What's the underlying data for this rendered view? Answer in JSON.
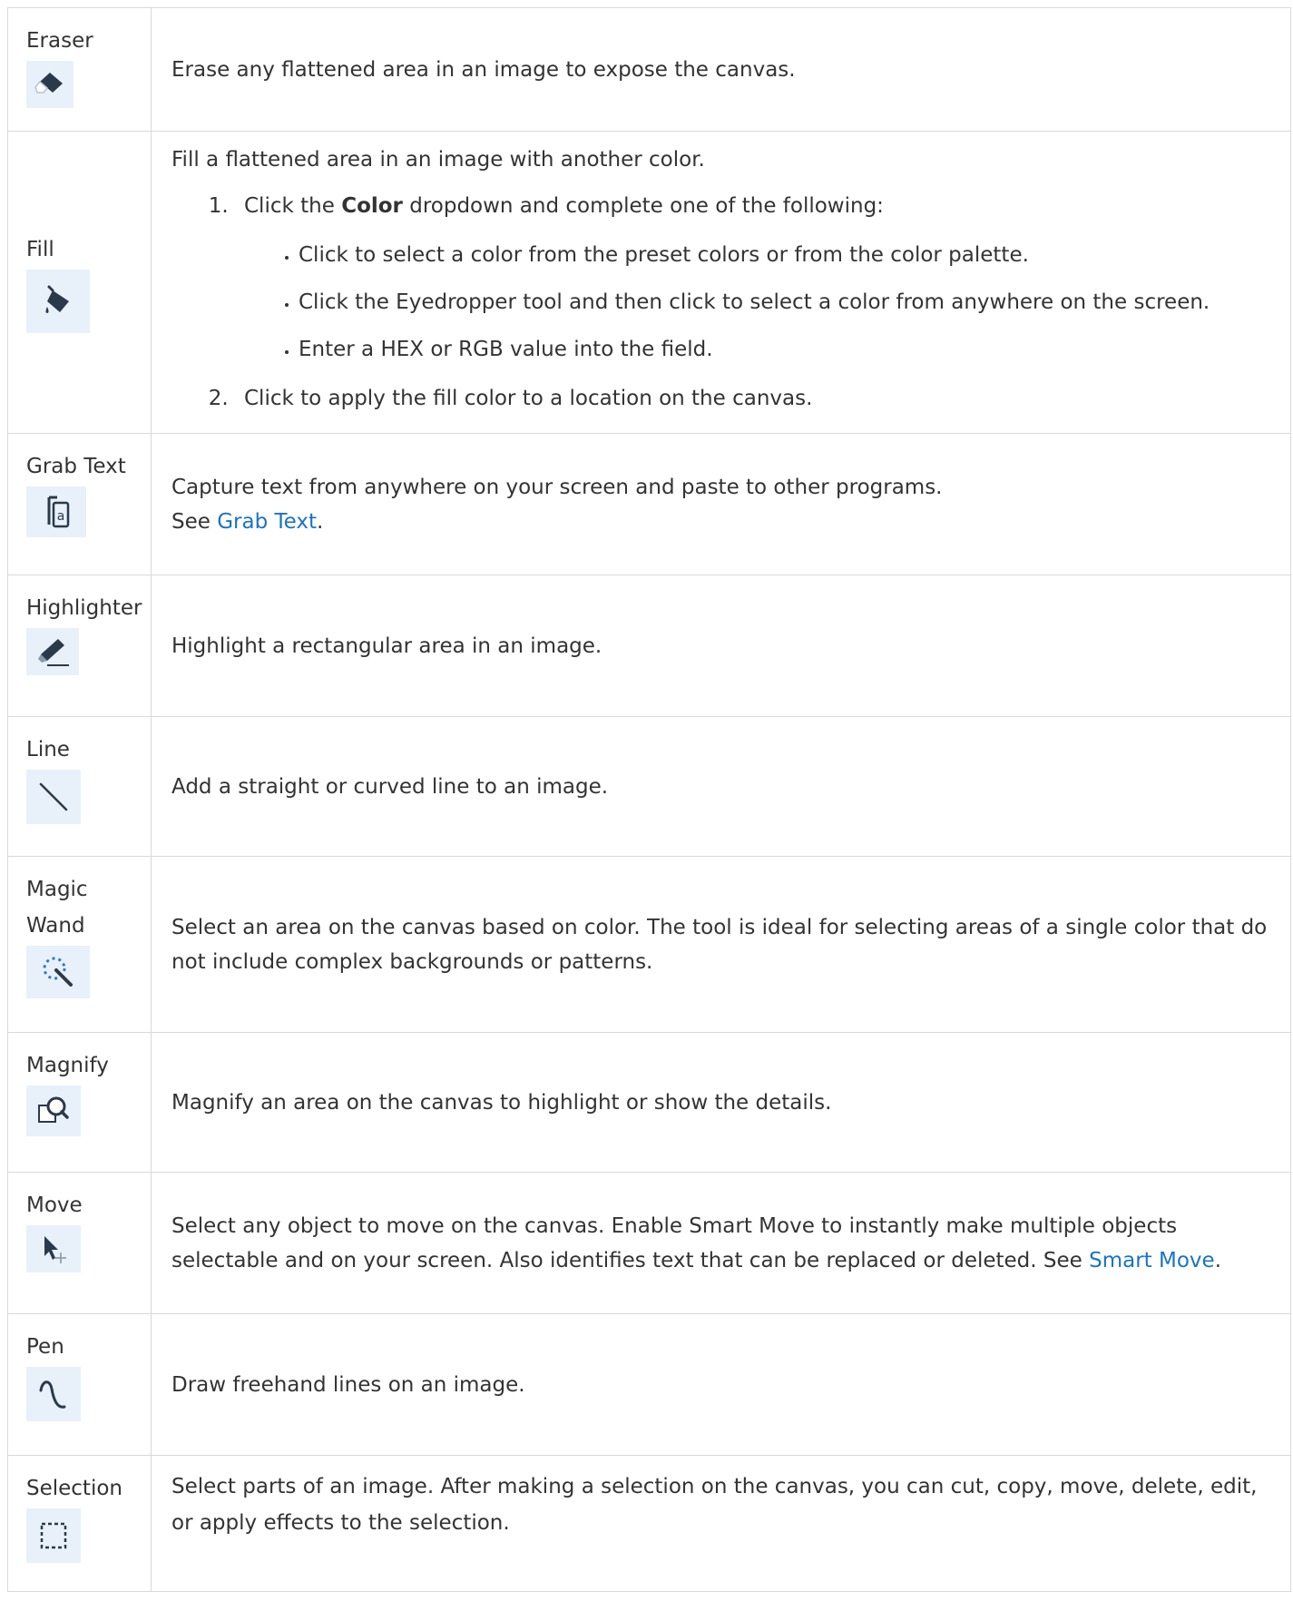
{
  "tools": [
    {
      "name": "Eraser",
      "icon": "eraser-icon",
      "desc": "Erase any flattened area in an image to expose the canvas."
    },
    {
      "name": "Fill",
      "icon": "fill-bucket-icon",
      "intro": "Fill a flattened area in an image with another color.",
      "step1_pre": "Click the ",
      "step1_bold": "Color",
      "step1_post": " dropdown and complete one of the following:",
      "options": [
        "Click to select a color from the preset colors or from the color palette.",
        "Click the Eyedropper tool and then click to select a color from anywhere on the screen.",
        "Enter a HEX or RGB value into the field."
      ],
      "step2": "Click to apply the fill color to a location on the canvas."
    },
    {
      "name": "Grab Text",
      "icon": "grab-text-icon",
      "line1": "Capture text from anywhere on your screen and paste to other programs.",
      "see_pre": "See ",
      "link": "Grab Text",
      "see_post": "."
    },
    {
      "name": "Highlighter",
      "icon": "highlighter-icon",
      "desc": "Highlight a rectangular area in an image."
    },
    {
      "name": "Line",
      "icon": "line-icon",
      "desc": "Add a straight or curved line to an image."
    },
    {
      "name": "Magic Wand",
      "icon": "magic-wand-icon",
      "desc": "Select an area on the canvas based on color. The tool is ideal for selecting areas of a single color that do not include complex backgrounds or patterns."
    },
    {
      "name": "Magnify",
      "icon": "magnify-icon",
      "desc": "Magnify an area on the canvas to highlight or show the details."
    },
    {
      "name": "Move",
      "icon": "move-icon",
      "desc_pre": "Select any object to move on the canvas. Enable Smart Move to instantly make multiple objects selectable and on your screen. Also identifies text that can be replaced or deleted. See ",
      "link": "Smart Move",
      "desc_post": "."
    },
    {
      "name": "Pen",
      "icon": "pen-icon",
      "desc": "Draw freehand lines on an image."
    },
    {
      "name": "Selection",
      "icon": "selection-icon",
      "desc": "Select parts of an image. After making a selection on the canvas, you can cut, copy, move, delete, edit, or apply effects to the selection."
    }
  ],
  "colors": {
    "icon_bg": "#e8f1fa",
    "icon_fg": "#2b3a4a",
    "link": "#1a73c7",
    "border": "#d9d9d9"
  }
}
